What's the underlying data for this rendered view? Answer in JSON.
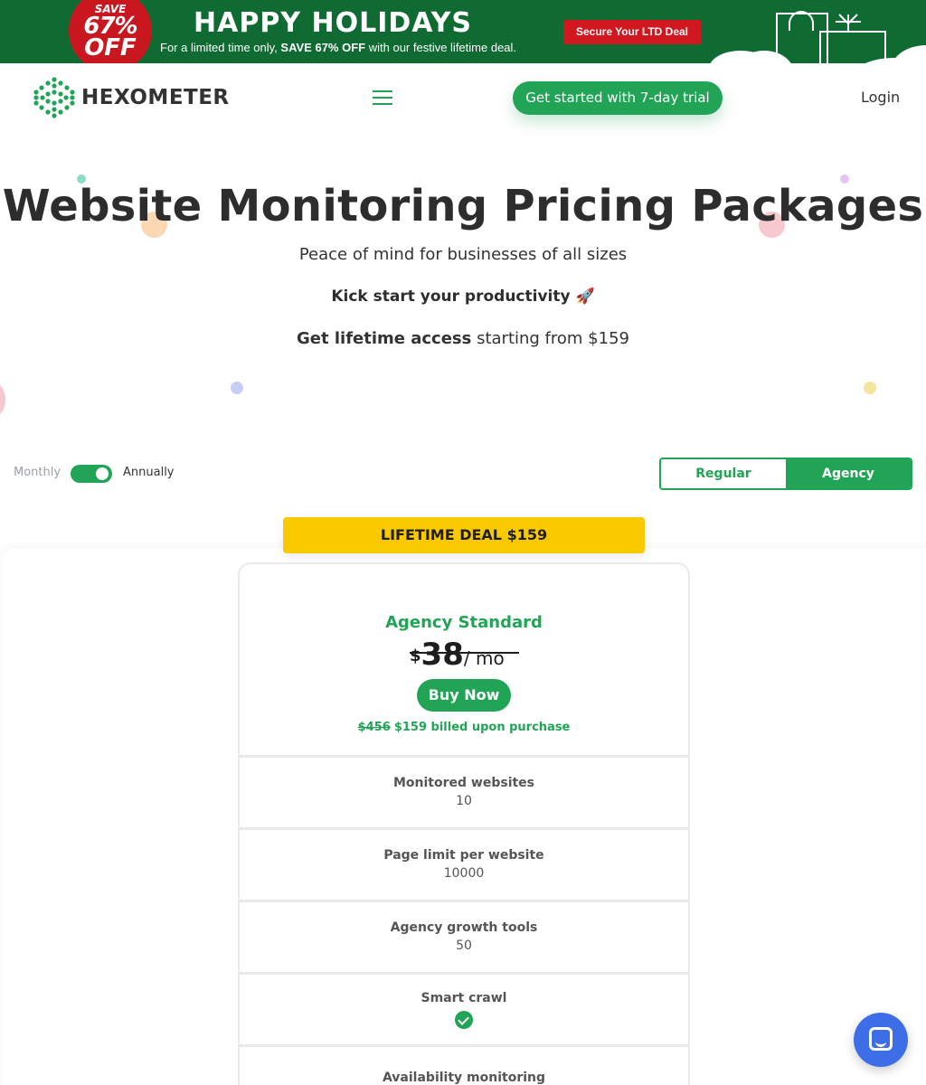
{
  "banner": {
    "badge_save": "SAVE",
    "badge_pct": "67%",
    "badge_off": "OFF",
    "title": "HAPPY HOLIDAYS",
    "sub_pre": "For a limited time only,",
    "sub_bold": "SAVE 67% OFF",
    "sub_post": "with our festive lifetime deal.",
    "cta": "Secure Your LTD Deal",
    "colors": {
      "background": "#0f6b32",
      "cta": "#d1171f",
      "badge": "#c8171e"
    }
  },
  "header": {
    "logo_text": "HEXOMETER",
    "menu_icon": "hamburger-icon",
    "trial_button": "Get started with 7-day trial",
    "login": "Login"
  },
  "hero": {
    "title": "Website Monitoring Pricing Packages",
    "subtitle": "Peace of mind for businesses of all sizes",
    "kick": "Kick start your productivity 🚀",
    "lifetime_bold": "Get lifetime access",
    "lifetime_rest": " starting from $159"
  },
  "billing": {
    "monthly": "Monthly",
    "annually": "Annually",
    "annual_selected": true
  },
  "plan_type": {
    "options": [
      "Regular",
      "Agency"
    ],
    "selected": "Agency"
  },
  "deal_badge": "LIFETIME DEAL $159",
  "plan": {
    "name": "Agency Standard",
    "currency": "$",
    "price": "38",
    "period": "/ mo",
    "buy_button": "Buy Now",
    "old_total": "$456",
    "billed": "$159 billed upon purchase",
    "features": [
      {
        "label": "Monitored websites",
        "value": "10"
      },
      {
        "label": "Page limit per website",
        "value": "10000"
      },
      {
        "label": "Agency growth tools",
        "value": "50"
      },
      {
        "label": "Smart crawl",
        "check": true
      },
      {
        "label": "Availability monitoring"
      }
    ]
  },
  "accent_color": "#22a456",
  "chat_icon": "chat-icon"
}
